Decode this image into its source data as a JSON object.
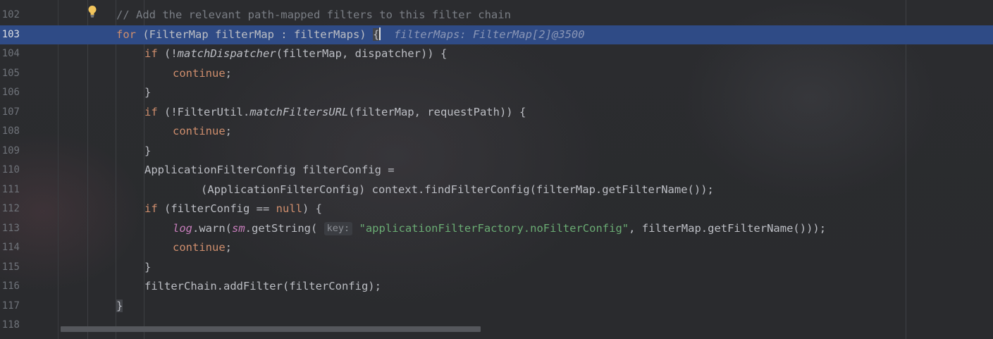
{
  "editor": {
    "lines": [
      {
        "num": "102",
        "current": false,
        "tokens": [
          {
            "t": "// Add the relevant path-mapped filters to this filter chain",
            "c": "cm"
          }
        ],
        "indent": 0
      },
      {
        "num": "103",
        "current": true,
        "tokens": [
          {
            "t": "for",
            "c": "kw"
          },
          {
            "t": " (FilterMap filterMap : filterMaps) "
          },
          {
            "t": "{",
            "c": "brace-hl"
          },
          {
            "t": "",
            "c": "caret"
          },
          {
            "t": "  filterMaps: FilterMap[2]@3500",
            "c": "inline-val"
          }
        ],
        "indent": 0
      },
      {
        "num": "104",
        "current": false,
        "tokens": [
          {
            "t": "if",
            "c": "kw"
          },
          {
            "t": " (!"
          },
          {
            "t": "matchDispatcher",
            "c": "fnI"
          },
          {
            "t": "(filterMap, dispatcher)) {"
          }
        ],
        "indent": 1
      },
      {
        "num": "105",
        "current": false,
        "tokens": [
          {
            "t": "continue",
            "c": "kw"
          },
          {
            "t": ";"
          }
        ],
        "indent": 2
      },
      {
        "num": "106",
        "current": false,
        "tokens": [
          {
            "t": "}"
          }
        ],
        "indent": 1
      },
      {
        "num": "107",
        "current": false,
        "tokens": [
          {
            "t": "if",
            "c": "kw"
          },
          {
            "t": " (!FilterUtil."
          },
          {
            "t": "matchFiltersURL",
            "c": "fnI"
          },
          {
            "t": "(filterMap, requestPath)) {"
          }
        ],
        "indent": 1
      },
      {
        "num": "108",
        "current": false,
        "tokens": [
          {
            "t": "continue",
            "c": "kw"
          },
          {
            "t": ";"
          }
        ],
        "indent": 2
      },
      {
        "num": "109",
        "current": false,
        "tokens": [
          {
            "t": "}"
          }
        ],
        "indent": 1
      },
      {
        "num": "110",
        "current": false,
        "tokens": [
          {
            "t": "ApplicationFilterConfig filterConfig ="
          }
        ],
        "indent": 1
      },
      {
        "num": "111",
        "current": false,
        "tokens": [
          {
            "t": "(ApplicationFilterConfig) context.findFilterConfig(filterMap.getFilterName());"
          }
        ],
        "indent": 3
      },
      {
        "num": "112",
        "current": false,
        "tokens": [
          {
            "t": "if",
            "c": "kw"
          },
          {
            "t": " (filterConfig == "
          },
          {
            "t": "null",
            "c": "kw"
          },
          {
            "t": ") {"
          }
        ],
        "indent": 1
      },
      {
        "num": "113",
        "current": false,
        "tokens": [
          {
            "t": "log",
            "c": "fld"
          },
          {
            "t": ".warn("
          },
          {
            "t": "sm",
            "c": "fld"
          },
          {
            "t": ".getString( "
          },
          {
            "t": "key:",
            "c": "hint"
          },
          {
            "t": " "
          },
          {
            "t": "\"applicationFilterFactory.noFilterConfig\"",
            "c": "str"
          },
          {
            "t": ", filterMap.getFilterName()));"
          }
        ],
        "indent": 2
      },
      {
        "num": "114",
        "current": false,
        "tokens": [
          {
            "t": "continue",
            "c": "kw"
          },
          {
            "t": ";"
          }
        ],
        "indent": 2
      },
      {
        "num": "115",
        "current": false,
        "tokens": [
          {
            "t": "}"
          }
        ],
        "indent": 1
      },
      {
        "num": "116",
        "current": false,
        "tokens": [
          {
            "t": "filterChain.addFilter(filterConfig);"
          }
        ],
        "indent": 1
      },
      {
        "num": "117",
        "current": false,
        "tokens": [
          {
            "t": "}",
            "c": "brace-hl"
          }
        ],
        "indent": 0
      },
      {
        "num": "118",
        "current": false,
        "tokens": [],
        "indent": 0
      }
    ]
  },
  "icons": {
    "intention": "lightbulb-icon"
  },
  "colors": {
    "accent": "#2f4b86",
    "keyword": "#cf8e6d",
    "string": "#6aab73",
    "comment": "#7a7e85",
    "field": "#c77dbb"
  }
}
